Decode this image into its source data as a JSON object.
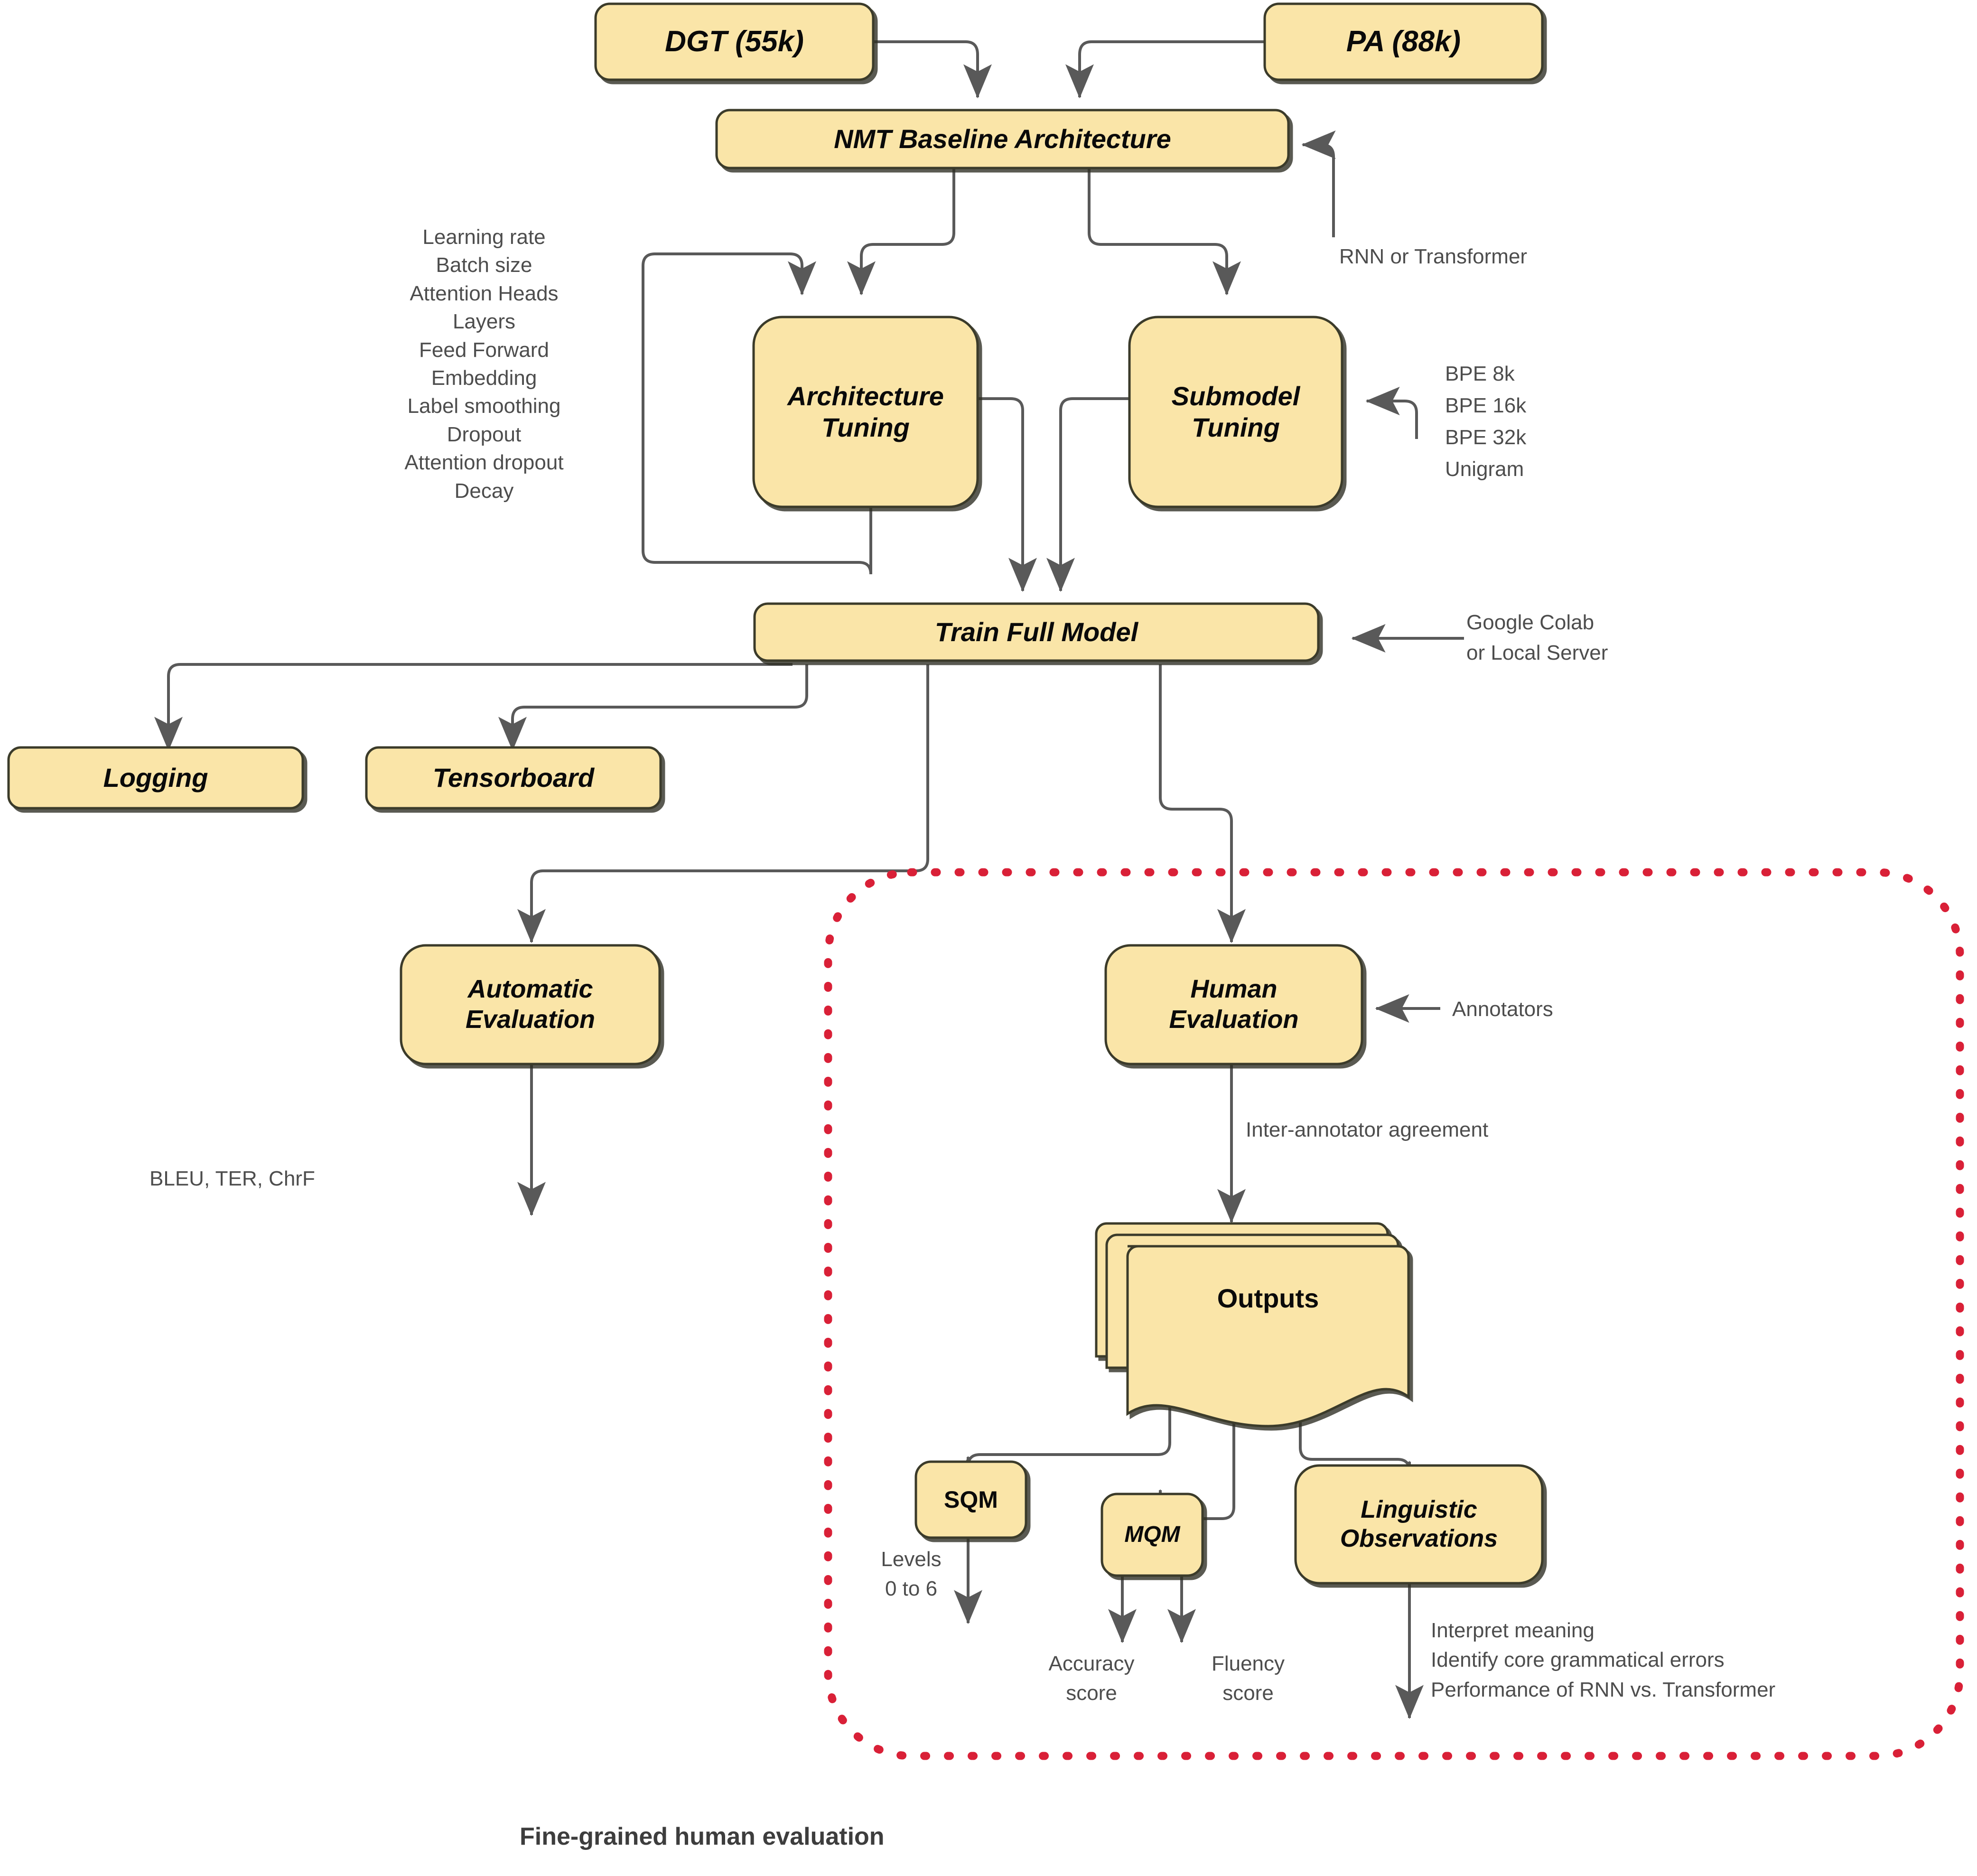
{
  "diagram": {
    "caption": "Fine-grained human evaluation",
    "colors": {
      "node_fill": "#FAE5A8",
      "node_stroke": "#3a3a2a",
      "edge": "#595959",
      "annotation_text": "#4d4d4d",
      "group_border": "#D92037"
    },
    "nodes": {
      "dgt": "DGT (55k)",
      "pa": "PA (88k)",
      "nmt_baseline": "NMT Baseline Architecture",
      "architecture_tuning": "Architecture\nTuning",
      "submodel_tuning": "Submodel\nTuning",
      "train_full_model": "Train Full Model",
      "logging": "Logging",
      "tensorboard": "Tensorboard",
      "automatic_evaluation": "Automatic\nEvaluation",
      "human_evaluation": "Human\nEvaluation",
      "outputs": "Outputs",
      "sqm": "SQM",
      "mqm": "MQM",
      "linguistic_observations": "Linguistic\nObservations"
    },
    "annotations": {
      "hyperparameters": "Learning rate\nBatch size\nAttention Heads\nLayers\nFeed Forward\nEmbedding\nLabel smoothing\nDropout\nAttention dropout\nDecay",
      "rnn_or_transformer": "RNN or Transformer",
      "tokenizers": "BPE 8k\nBPE 16k\nBPE 32k\nUnigram",
      "compute": "Google Colab\nor Local Server",
      "automatic_metrics": "BLEU, TER, ChrF",
      "annotators": "Annotators",
      "inter_annotator": "Inter-annotator agreement",
      "levels": "Levels\n0 to 6",
      "accuracy_score": "Accuracy\nscore",
      "fluency_score": "Fluency\nscore",
      "linguistic_notes": "Interpret meaning\nIdentify core grammatical errors\nPerformance of RNN vs. Transformer"
    }
  }
}
